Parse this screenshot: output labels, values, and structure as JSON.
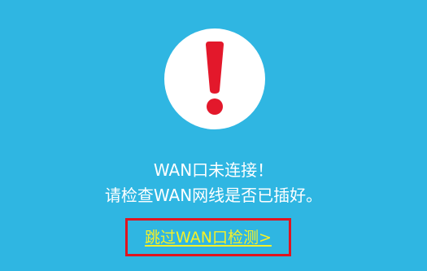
{
  "alert": {
    "icon": "exclamation-icon",
    "icon_color": "#e3182b",
    "circle_color": "#ffffff"
  },
  "message": {
    "title": "WAN口未连接！",
    "subtitle": "请检查WAN网线是否已插好。"
  },
  "skip": {
    "label": "跳过WAN口检测>",
    "color": "#f7f126",
    "highlight_border_color": "#e0141f"
  },
  "colors": {
    "background": "#2fb6e2",
    "text": "#ffffff"
  }
}
